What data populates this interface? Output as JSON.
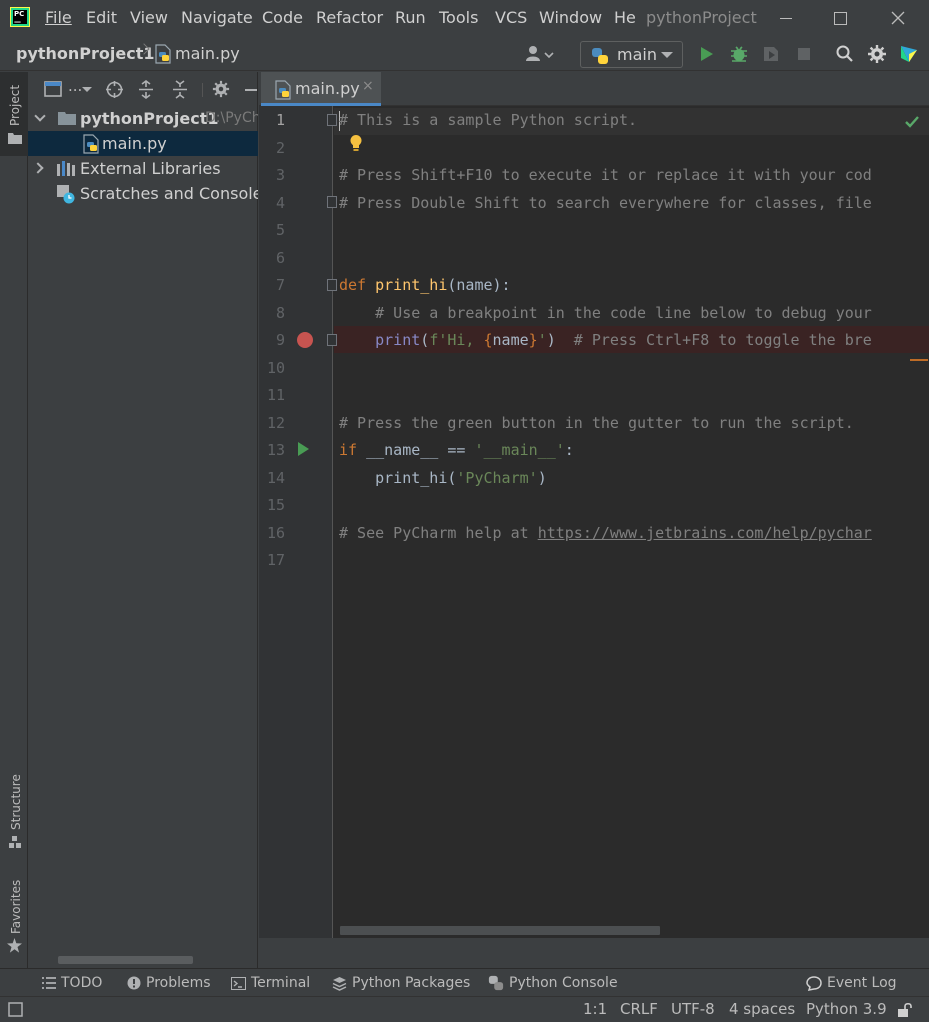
{
  "menubar": {
    "items": [
      "File",
      "Edit",
      "View",
      "Navigate",
      "Code",
      "Refactor",
      "Run",
      "Tools",
      "VCS",
      "Window",
      "He"
    ],
    "window_title": "pythonProject"
  },
  "navbar": {
    "project": "pythonProject1",
    "file": "main.py",
    "run_config": "main"
  },
  "left_stripe": {
    "project": "Project",
    "structure": "Structure",
    "favorites": "Favorites"
  },
  "project_panel": {
    "toolbar_dropdown": "...",
    "tree": {
      "root": "pythonProject1",
      "root_path": "D:\\PyCh",
      "file": "main.py",
      "external": "External Libraries",
      "scratches": "Scratches and Consoles"
    }
  },
  "editor": {
    "tab": "main.py",
    "tab_close": "×",
    "line_numbers": [
      "1",
      "2",
      "3",
      "4",
      "5",
      "6",
      "7",
      "8",
      "9",
      "10",
      "11",
      "12",
      "13",
      "14",
      "15",
      "16",
      "17"
    ],
    "lines": {
      "l1": "# This is a sample Python script.",
      "l3": "# Press Shift+F10 to execute it or replace it with your cod",
      "l4": "# Press Double Shift to search everywhere for classes, file",
      "l7_def": "def",
      "l7_name": "print_hi",
      "l7_rest": "(name):",
      "l8": "    # Use a breakpoint in the code line below to debug your",
      "l9_indent": "    ",
      "l9_print": "print",
      "l9_open": "(",
      "l9_str1": "f'Hi, ",
      "l9_brace_open": "{",
      "l9_var": "name",
      "l9_brace_close": "}",
      "l9_str2": "'",
      "l9_close": ")",
      "l9_comment": "  # Press Ctrl+F8 to toggle the bre",
      "l12": "# Press the green button in the gutter to run the script.",
      "l13_if": "if",
      "l13_mid": " __name__ == ",
      "l13_str": "'__main__'",
      "l13_colon": ":",
      "l14_indent": "    ",
      "l14_call": "print_hi(",
      "l14_str": "'PyCharm'",
      "l14_close": ")",
      "l16_text": "# See PyCharm help at ",
      "l16_link": "https://www.jetbrains.com/help/pychar"
    }
  },
  "tool_windows": {
    "todo": "TODO",
    "problems": "Problems",
    "terminal": "Terminal",
    "packages": "Python Packages",
    "console": "Python Console",
    "event_log": "Event Log"
  },
  "status": {
    "position": "1:1",
    "line_sep": "CRLF",
    "encoding": "UTF-8",
    "indent": "4 spaces",
    "interpreter": "Python 3.9"
  },
  "colors": {
    "accent": "#4a88c7",
    "breakpoint": "#c75450",
    "run": "#499c54",
    "debug": "#59a869"
  }
}
